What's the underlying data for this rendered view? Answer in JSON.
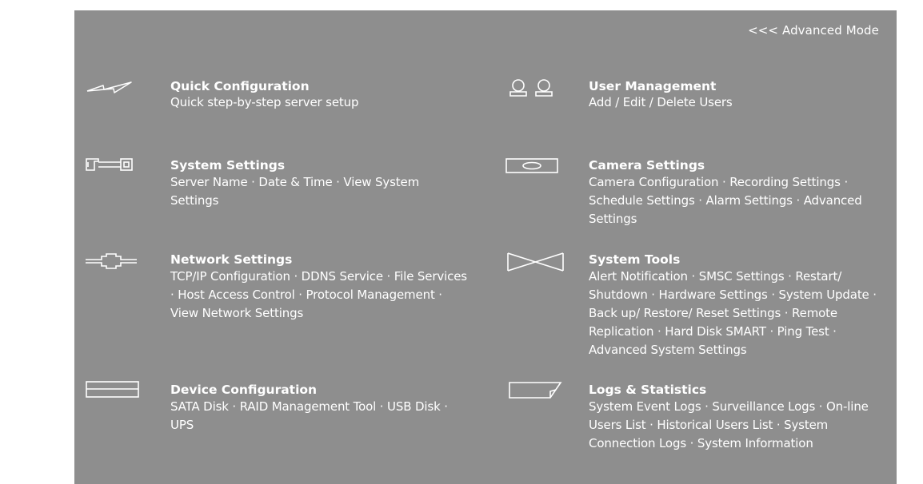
{
  "header": {
    "advanced_mode_link": "<<< Advanced Mode"
  },
  "items": {
    "quick_config": {
      "icon": "lightning-icon",
      "title": "Quick Configuration",
      "desc": "Quick step-by-step server setup"
    },
    "system_settings": {
      "icon": "server-icon",
      "title": "System Settings",
      "desc": "Server Name · Date & Time · View System Settings"
    },
    "network_settings": {
      "icon": "network-icon",
      "title": "Network Settings",
      "desc": "TCP/IP Configuration · DDNS Service · File Services · Host Access Control · Protocol Management · View Network Settings"
    },
    "device_config": {
      "icon": "drive-icon",
      "title": "Device Configuration",
      "desc": "SATA Disk · RAID Management Tool · USB Disk · UPS"
    },
    "user_management": {
      "icon": "users-icon",
      "title": "User Management",
      "desc": "Add / Edit / Delete Users"
    },
    "camera_settings": {
      "icon": "camera-icon",
      "title": "Camera Settings",
      "desc": "Camera Configuration · Recording Settings · Schedule Settings · Alarm Settings · Advanced Settings"
    },
    "system_tools": {
      "icon": "tools-icon",
      "title": "System Tools",
      "desc": "Alert Notification · SMSC Settings · Restart/ Shutdown · Hardware Settings · System Update · Back up/ Restore/ Reset Settings · Remote Replication · Hard Disk SMART · Ping Test · Advanced System Settings"
    },
    "logs_statistics": {
      "icon": "logs-icon",
      "title": "Logs & Statistics",
      "desc": "System Event Logs · Surveillance Logs · On-line Users List · Historical Users List · System Connection Logs · System Information"
    }
  },
  "colors": {
    "panel_bg": "#8e8e8e",
    "text": "#ffffff",
    "page_bg": "#ffffff"
  }
}
